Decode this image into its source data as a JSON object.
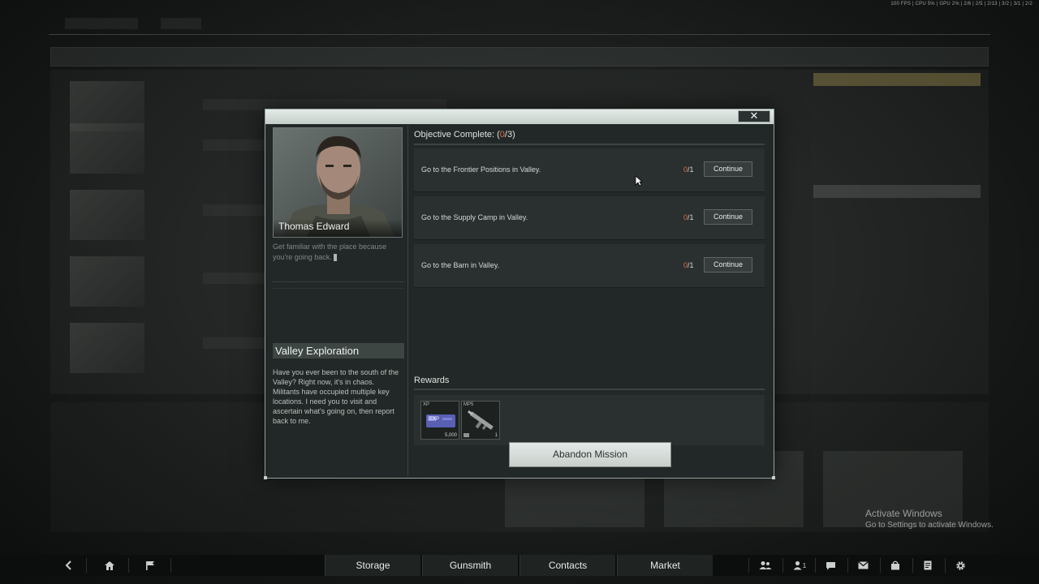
{
  "system_info": "100 FPS | CPU 5% | GPU 2% | 2/6 | 2/5 | 2/13 | 3/2 | 3/1 | 2/2",
  "windows_activation": {
    "title": "Activate Windows",
    "subtitle": "Go to Settings to activate Windows."
  },
  "mission_dialog": {
    "close_symbol": "✕",
    "contact": {
      "name": "Thomas Edward",
      "quote": "Get familiar with the place because you're going back."
    },
    "mission": {
      "title": "Valley Exploration",
      "description": "Have you ever been to the south of the Valley? Right now, it's in chaos. Militants have occupied multiple key locations. I need you to visit and ascertain what's going on, then report back to me."
    },
    "objectives_header": {
      "label": "Objective Complete: (",
      "done": "0",
      "total": "/3)"
    },
    "objectives": [
      {
        "text": "Go to the Frontier Positions in Valley.",
        "done": "0",
        "total": "/1",
        "button": "Continue"
      },
      {
        "text": "Go to the Supply Camp in Valley.",
        "done": "0",
        "total": "/1",
        "button": "Continue"
      },
      {
        "text": "Go to the Barn in Valley.",
        "done": "0",
        "total": "/1",
        "button": "Continue"
      }
    ],
    "rewards_label": "Rewards",
    "rewards": [
      {
        "label": "XP",
        "quantity": "5,000",
        "icon": "exp-card-icon"
      },
      {
        "label": "MP5",
        "quantity": "1",
        "icon": "smg-icon"
      }
    ],
    "abandon_button": "Abandon Mission"
  },
  "bottom_nav": {
    "tabs": [
      "Storage",
      "Gunsmith",
      "Contacts",
      "Market"
    ],
    "left_icons": [
      "back-arrow-icon",
      "home-icon",
      "flag-icon"
    ],
    "right_icons": [
      "squad-icon",
      "friends-icon",
      "chat-icon",
      "mail-icon",
      "shop-icon",
      "notes-icon",
      "gear-icon"
    ],
    "friends_count": "1"
  }
}
